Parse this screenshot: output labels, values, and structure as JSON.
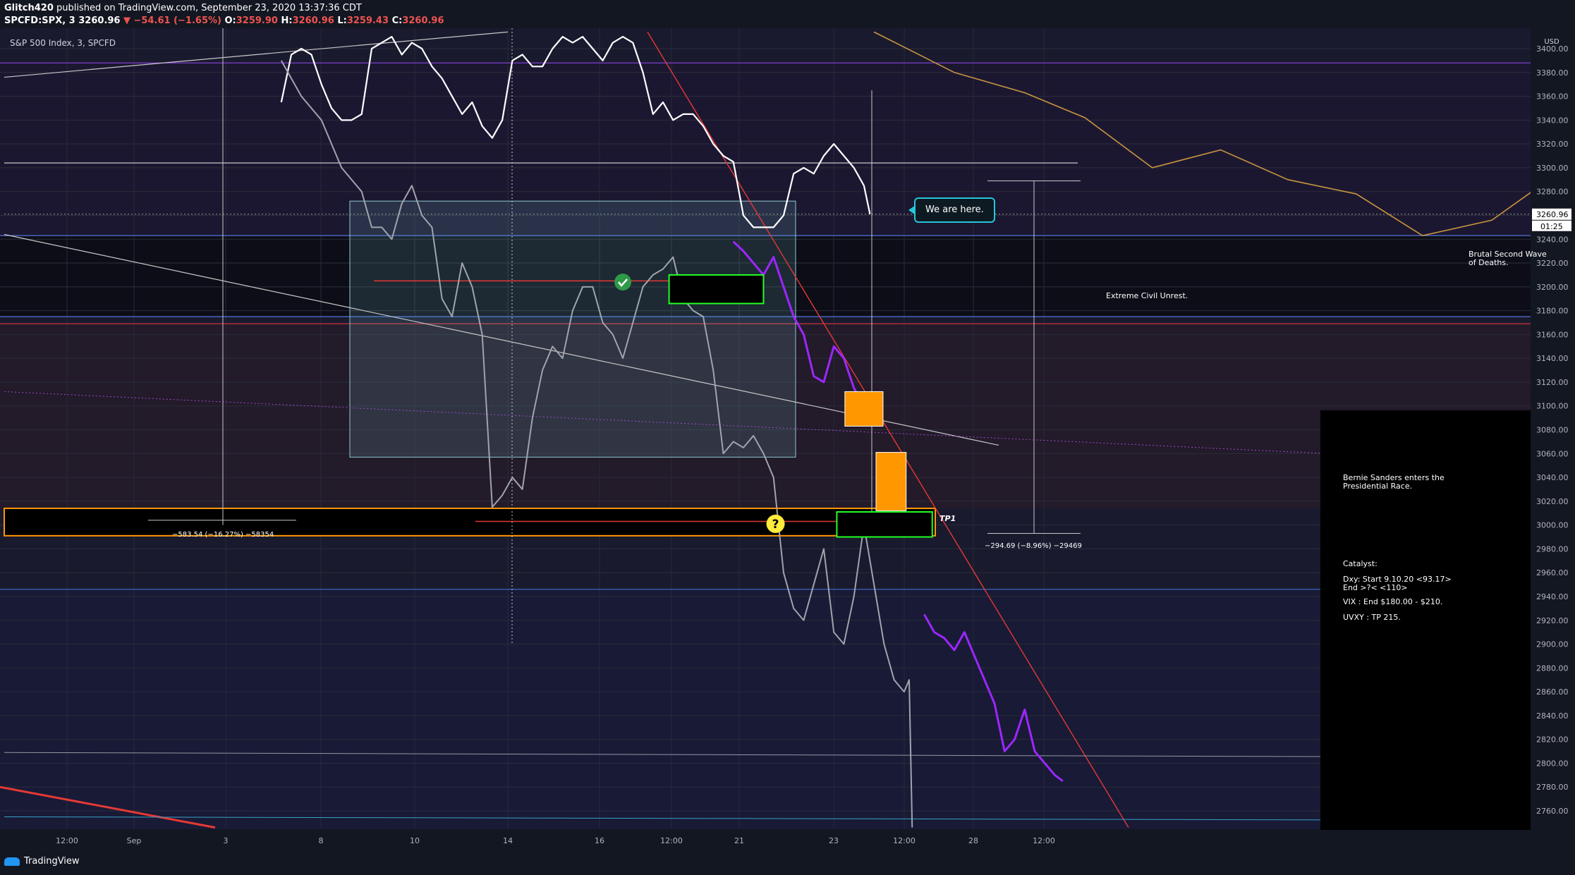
{
  "header": {
    "author": "Glitch420",
    "published": "published on TradingView.com, September 23, 2020 13:37:36 CDT",
    "symbol": "SPCFD:SPX, 3",
    "last": "3260.96",
    "change": "▼ −54.61 (−1.65%)",
    "ohlc_o_label": "O:",
    "ohlc_o": "3259.90",
    "ohlc_h_label": "H:",
    "ohlc_h": "3260.96",
    "ohlc_l_label": "L:",
    "ohlc_l": "3259.43",
    "ohlc_c_label": "C:",
    "ohlc_c": "3260.96"
  },
  "symbol_label": "S&P 500 Index, 3, SPCFD",
  "footer": {
    "brand": "TradingView"
  },
  "annotations": {
    "we_are_here": "We are here.",
    "extreme_unrest": "Extreme Civil Unrest.",
    "brutal_wave": "Brutal Second Wave\nof Deaths.",
    "tp1": "TP1",
    "measure_left": "−583.54 (−16.27%) −58354",
    "measure_right": "−294.69 (−8.96%) −29469",
    "question": "?",
    "panel_bernie": "Bernie Sanders enters the\nPresidential Race.",
    "panel_catalyst": "Catalyst:",
    "panel_dxy": "Dxy: Start 9.10.20 <93.17>\nEnd >?< <110>",
    "panel_vix": "VIX : End $180.00 - $210.",
    "panel_uvxy": "UVXY : TP 215."
  },
  "colors": {
    "background": "#131722",
    "price_line": "#ffffff",
    "projection": "#9c27ff",
    "ghost": "#a0a4ad",
    "zone_orange": "#ff9800",
    "box_green": "#22ff22",
    "trend_red": "#e53935",
    "dxy_line": "#c8963e",
    "box_teal": "#8fc9d0"
  },
  "chart_data": {
    "type": "line",
    "title": "S&P 500 Index, 3, SPCFD",
    "currency": "USD",
    "y_ticks": [
      2760,
      2780,
      2800,
      2820,
      2840,
      2860,
      2880,
      2900,
      2920,
      2940,
      2960,
      2980,
      3000,
      3020,
      3040,
      3060,
      3080,
      3100,
      3120,
      3140,
      3160,
      3180,
      3200,
      3220,
      3240,
      3260,
      3280,
      3300,
      3320,
      3340,
      3360,
      3380,
      3400
    ],
    "ylim": [
      2746,
      3414
    ],
    "x_tick_labels": [
      "12:00",
      "Sep",
      "3",
      "8",
      "10",
      "14",
      "16",
      "12:00",
      "21",
      "23",
      "12:00",
      "28",
      "12:00"
    ],
    "last_price_label": "3260.96",
    "countdown_label": "01:25",
    "series": [
      {
        "name": "",
        "values": [
          [
            280,
            3355
          ],
          [
            290,
            3395
          ],
          [
            300,
            3400
          ],
          [
            310,
            3395
          ],
          [
            320,
            3370
          ],
          [
            330,
            3350
          ],
          [
            340,
            3340
          ],
          [
            350,
            3340
          ],
          [
            360,
            3345
          ],
          [
            370,
            3400
          ],
          [
            380,
            3405
          ],
          [
            390,
            3410
          ],
          [
            400,
            3395
          ],
          [
            410,
            3405
          ],
          [
            420,
            3400
          ],
          [
            430,
            3385
          ],
          [
            440,
            3375
          ],
          [
            450,
            3360
          ],
          [
            460,
            3345
          ],
          [
            470,
            3355
          ],
          [
            480,
            3335
          ],
          [
            490,
            3325
          ],
          [
            500,
            3340
          ],
          [
            510,
            3390
          ],
          [
            520,
            3395
          ],
          [
            530,
            3385
          ],
          [
            540,
            3385
          ],
          [
            550,
            3400
          ],
          [
            560,
            3410
          ],
          [
            570,
            3405
          ],
          [
            580,
            3410
          ],
          [
            590,
            3400
          ],
          [
            600,
            3390
          ],
          [
            610,
            3405
          ],
          [
            620,
            3410
          ],
          [
            630,
            3405
          ],
          [
            640,
            3380
          ],
          [
            650,
            3345
          ],
          [
            660,
            3355
          ],
          [
            670,
            3340
          ],
          [
            680,
            3345
          ],
          [
            690,
            3345
          ],
          [
            700,
            3335
          ],
          [
            710,
            3320
          ],
          [
            720,
            3310
          ],
          [
            730,
            3305
          ],
          [
            740,
            3260
          ],
          [
            750,
            3250
          ],
          [
            760,
            3250
          ],
          [
            770,
            3250
          ],
          [
            780,
            3260
          ],
          [
            790,
            3295
          ],
          [
            800,
            3300
          ],
          [
            810,
            3295
          ],
          [
            820,
            3310
          ],
          [
            830,
            3320
          ],
          [
            840,
            3310
          ],
          [
            850,
            3300
          ],
          [
            860,
            3285
          ],
          [
            866,
            3261
          ]
        ]
      },
      {
        "name": "",
        "values": [
          [
            730,
            3238
          ],
          [
            740,
            3230
          ],
          [
            750,
            3220
          ],
          [
            760,
            3210
          ],
          [
            770,
            3225
          ],
          [
            780,
            3200
          ],
          [
            790,
            3175
          ],
          [
            800,
            3160
          ],
          [
            810,
            3125
          ],
          [
            820,
            3120
          ],
          [
            830,
            3150
          ],
          [
            840,
            3140
          ],
          [
            850,
            3115
          ],
          [
            860,
            3100
          ]
        ]
      },
      {
        "name": "",
        "values": [
          [
            920,
            2925
          ],
          [
            930,
            2910
          ],
          [
            940,
            2905
          ],
          [
            950,
            2895
          ],
          [
            960,
            2910
          ],
          [
            970,
            2890
          ],
          [
            980,
            2870
          ],
          [
            990,
            2850
          ],
          [
            1000,
            2810
          ],
          [
            1010,
            2820
          ],
          [
            1020,
            2845
          ],
          [
            1030,
            2810
          ],
          [
            1040,
            2800
          ],
          [
            1050,
            2790
          ],
          [
            1058,
            2785
          ]
        ]
      },
      {
        "name": "",
        "values": [
          [
            280,
            3390
          ],
          [
            300,
            3360
          ],
          [
            320,
            3340
          ],
          [
            340,
            3300
          ],
          [
            360,
            3280
          ],
          [
            370,
            3250
          ],
          [
            380,
            3250
          ],
          [
            390,
            3240
          ],
          [
            400,
            3270
          ],
          [
            410,
            3285
          ],
          [
            420,
            3260
          ],
          [
            430,
            3250
          ],
          [
            440,
            3190
          ],
          [
            450,
            3175
          ],
          [
            460,
            3220
          ],
          [
            470,
            3200
          ],
          [
            480,
            3160
          ],
          [
            490,
            3015
          ],
          [
            500,
            3025
          ],
          [
            510,
            3040
          ],
          [
            520,
            3030
          ],
          [
            530,
            3090
          ],
          [
            540,
            3130
          ],
          [
            550,
            3150
          ],
          [
            560,
            3140
          ],
          [
            570,
            3180
          ],
          [
            580,
            3200
          ],
          [
            590,
            3200
          ],
          [
            600,
            3170
          ],
          [
            610,
            3160
          ],
          [
            620,
            3140
          ],
          [
            630,
            3170
          ],
          [
            640,
            3200
          ],
          [
            650,
            3210
          ],
          [
            660,
            3215
          ],
          [
            670,
            3225
          ],
          [
            680,
            3190
          ],
          [
            690,
            3180
          ],
          [
            700,
            3175
          ],
          [
            710,
            3130
          ],
          [
            720,
            3060
          ],
          [
            730,
            3070
          ],
          [
            740,
            3065
          ],
          [
            750,
            3075
          ],
          [
            760,
            3060
          ],
          [
            770,
            3040
          ],
          [
            780,
            2960
          ],
          [
            790,
            2930
          ],
          [
            800,
            2920
          ],
          [
            810,
            2950
          ],
          [
            820,
            2980
          ],
          [
            830,
            2910
          ],
          [
            840,
            2900
          ],
          [
            850,
            2940
          ],
          [
            860,
            3000
          ],
          [
            870,
            2950
          ],
          [
            880,
            2900
          ],
          [
            890,
            2870
          ],
          [
            900,
            2860
          ],
          [
            905,
            2870
          ],
          [
            908,
            2746
          ]
        ]
      }
    ],
    "horizontal_levels": [
      3388,
      3175,
      3169,
      3243,
      2946
    ],
    "orange_zone": [
      2991,
      3014
    ],
    "green_boxes": [
      {
        "x0": 666,
        "x1": 760,
        "top": 3210,
        "bottom": 3186
      },
      {
        "x0": 833,
        "x1": 928,
        "top": 3011,
        "bottom": 2990
      }
    ],
    "orange_boxes": [
      {
        "x0": 841,
        "x1": 879,
        "top": 3112,
        "bottom": 3083
      },
      {
        "x0": 872,
        "x1": 902,
        "top": 3061,
        "bottom": 3012
      }
    ],
    "dxy_overlay": [
      [
        870,
        3414
      ],
      [
        950,
        3380
      ],
      [
        1020,
        3363
      ],
      [
        1080,
        3342
      ],
      [
        1147,
        3300
      ],
      [
        1215,
        3315
      ],
      [
        1282,
        3290
      ],
      [
        1350,
        3278
      ],
      [
        1416,
        3243
      ],
      [
        1485,
        3256
      ],
      [
        1525,
        3280
      ]
    ]
  }
}
